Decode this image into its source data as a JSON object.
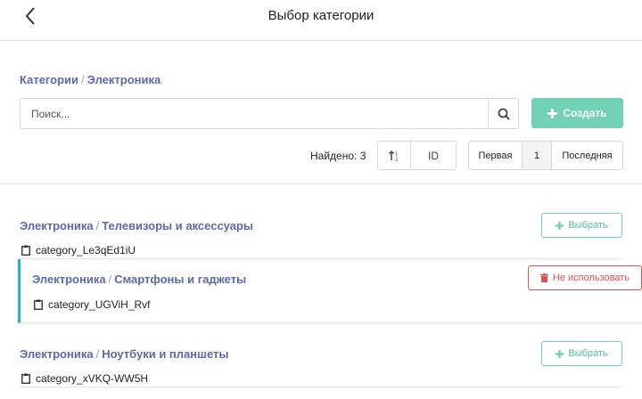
{
  "header": {
    "title": "Выбор категории"
  },
  "breadcrumb": {
    "root": "Категории",
    "sep": "/",
    "current": "Электроника"
  },
  "search": {
    "placeholder": "Поиск...",
    "value": ""
  },
  "create_label": "Создать",
  "found_label": "Найдено: 3",
  "sort": {
    "id_label": "ID"
  },
  "pager": {
    "first": "Первая",
    "current": "1",
    "last": "Последняя"
  },
  "items": [
    {
      "parent": "Электроника",
      "name": "Телевизоры и аксессуары",
      "id": "category_Le3qEd1iU",
      "action": "Выбрать"
    },
    {
      "parent": "Электроника",
      "name": "Смартфоны и гаджеты",
      "id": "category_UGViH_Rvf",
      "action": "Не использовать"
    },
    {
      "parent": "Электроника",
      "name": "Ноутбуки и планшеты",
      "id": "category_xVKQ-WW5H",
      "action": "Выбрать"
    }
  ],
  "colors": {
    "accent": "#72d2b4",
    "link": "#5a6aaa",
    "danger": "#d9534f",
    "active_bar": "#2ab3c0"
  }
}
